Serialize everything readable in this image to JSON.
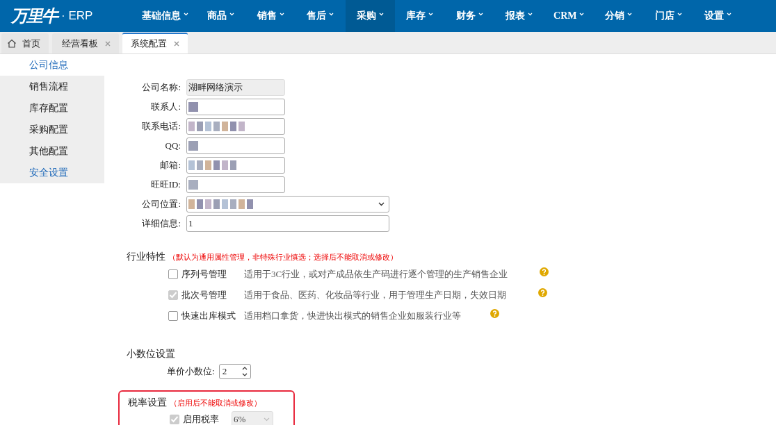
{
  "header": {
    "logo": "万里牛",
    "logo_suffix": "· ERP"
  },
  "menu": [
    {
      "label": "基础信息",
      "selected": false
    },
    {
      "label": "商品",
      "selected": false
    },
    {
      "label": "销售",
      "selected": false
    },
    {
      "label": "售后",
      "selected": false
    },
    {
      "label": "采购",
      "selected": true
    },
    {
      "label": "库存",
      "selected": false
    },
    {
      "label": "财务",
      "selected": false
    },
    {
      "label": "报表",
      "selected": false
    },
    {
      "label": "CRM",
      "selected": false
    },
    {
      "label": "分销",
      "selected": false
    },
    {
      "label": "门店",
      "selected": false
    },
    {
      "label": "设置",
      "selected": false
    }
  ],
  "tabs": [
    {
      "label": "首页",
      "kind": "home",
      "selected": false
    },
    {
      "label": "经营看板",
      "kind": "closable",
      "selected": false
    },
    {
      "label": "系统配置",
      "kind": "closable",
      "selected": true
    }
  ],
  "sidebar": {
    "items": [
      {
        "label": "公司信息",
        "selected": true,
        "hover": false
      },
      {
        "label": "销售流程",
        "selected": false,
        "hover": false
      },
      {
        "label": "库存配置",
        "selected": false,
        "hover": false
      },
      {
        "label": "采购配置",
        "selected": false,
        "hover": false
      },
      {
        "label": "其他配置",
        "selected": false,
        "hover": false
      },
      {
        "label": "安全设置",
        "selected": false,
        "hover": true
      }
    ]
  },
  "company_form": [
    {
      "label": "公司名称:",
      "kind": "text",
      "value": "湖畔网络演示",
      "disabled": true,
      "wide": false,
      "redacted": false
    },
    {
      "label": "联系人:",
      "kind": "text",
      "disabled": false,
      "wide": false,
      "redacted": true
    },
    {
      "label": "联系电话:",
      "kind": "text",
      "disabled": false,
      "wide": false,
      "redacted": true
    },
    {
      "label": "QQ:",
      "kind": "text",
      "disabled": false,
      "wide": false,
      "redacted": true
    },
    {
      "label": "邮箱:",
      "kind": "text",
      "disabled": false,
      "wide": false,
      "redacted": true
    },
    {
      "label": "旺旺ID:",
      "kind": "text",
      "disabled": false,
      "wide": false,
      "redacted": true
    },
    {
      "label": "公司位置:",
      "kind": "select",
      "disabled": false,
      "wide": true,
      "redacted": true
    },
    {
      "label": "详细信息:",
      "kind": "text",
      "value": "1",
      "disabled": false,
      "wide": true,
      "redacted": false
    }
  ],
  "industry": {
    "title": "行业特性",
    "note": "（默认为通用属性管理，非特殊行业慎选；选择后不能取消或修改）",
    "options": [
      {
        "label": "序列号管理",
        "description": "适用于3C行业，或对产成品依生产码进行逐个管理的生产销售企业",
        "checked": false
      },
      {
        "label": "批次号管理",
        "description": "适用于食品、医药、化妆品等行业，用于管理生产日期，失效日期",
        "checked": true
      },
      {
        "label": "快速出库模式",
        "description": "适用档口拿货，快进快出模式的销售企业如服装行业等",
        "checked": false
      }
    ]
  },
  "decimal": {
    "title": "小数位设置",
    "label": "单价小数位:",
    "value": "2"
  },
  "tax": {
    "title": "税率设置",
    "note": "（启用后不能取消或修改）",
    "label": "启用税率",
    "checked": true,
    "rate": "6%",
    "highlighted": true
  }
}
